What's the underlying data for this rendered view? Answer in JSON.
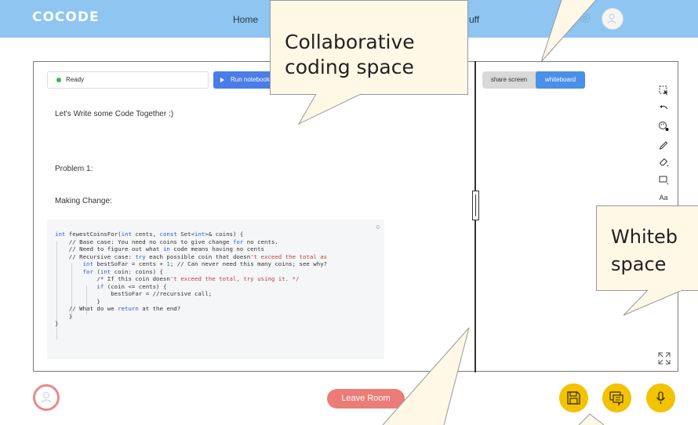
{
  "header": {
    "logo": "COCODE",
    "nav": {
      "home": "Home",
      "stuff_partial": "uff"
    }
  },
  "notebook": {
    "status": "Ready",
    "run_button": "Run notebook",
    "intro": "Let's Write some Code Together :)",
    "problem": "Problem 1:",
    "subtitle": "Making Change:",
    "cell_index": "0",
    "code_lines": [
      "int fewestCoinsFor(int cents, const Set<int>& coins) {",
      "    // Base case: You need no coins to give change for no cents.",
      "    // Need to figure out what in code means having no cents",
      "    // Recursive case: try each possible coin that doesn't exceed the total as",
      "        int bestSoFar = cents + 1; // Can never need this many coins; see why?",
      "        for (int coin: coins) {",
      "            /* If this coin doesn't exceed the total, try using it. */",
      "            if (coin <= cents) {",
      "                bestSoFar = //recursive call;",
      "            }",
      "    // What do we return at the end?",
      "    }",
      "}"
    ]
  },
  "whiteboard": {
    "tabs": {
      "share_screen": "share screen",
      "whiteboard": "whiteboard"
    },
    "active_tab": "whiteboard",
    "tools": [
      "select-icon",
      "undo-icon",
      "palette-icon",
      "pencil-icon",
      "eraser-icon",
      "rectangle-icon",
      "text-icon"
    ],
    "text_tool_label": "Aa"
  },
  "callouts": {
    "coding": [
      "Collaborative",
      "coding space"
    ],
    "whiteboard": [
      "Whiteb",
      "space"
    ]
  },
  "footer": {
    "leave_room": "Leave Room",
    "controls": [
      "save-icon",
      "chat-icon",
      "microphone-icon"
    ]
  },
  "colors": {
    "header_bg": "#8ec5f1",
    "primary_blue": "#4a7de8",
    "leave_red": "#ec7c77",
    "control_yellow": "#f3c200",
    "callout_bg": "#fff8e6"
  }
}
